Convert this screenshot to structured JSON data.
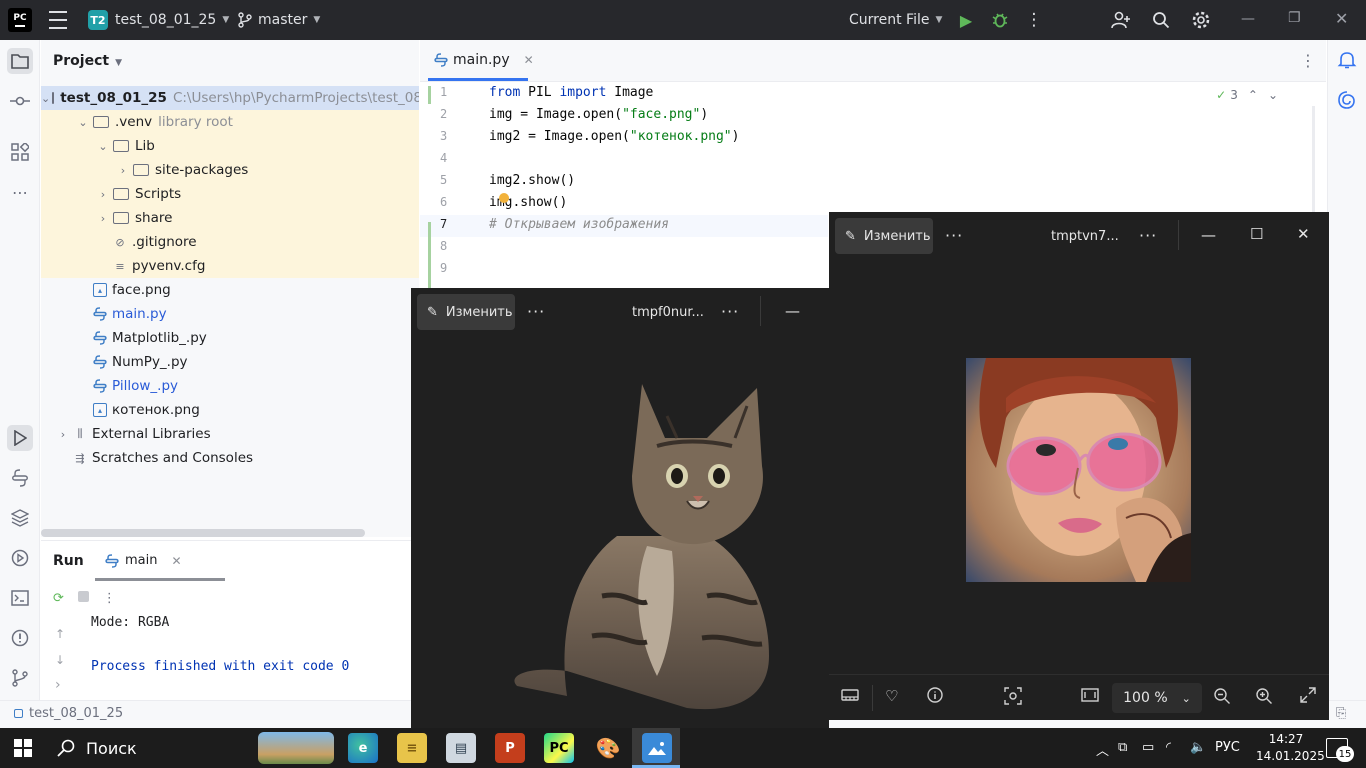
{
  "titlebar": {
    "logo": "PC",
    "project_badge": "T2",
    "project_name": "test_08_01_25",
    "branch": "master",
    "run_config": "Current File"
  },
  "project_panel": {
    "title": "Project",
    "tree": [
      {
        "label": "test_08_01_25",
        "hint": "C:\\Users\\hp\\PycharmProjects\\test_08",
        "type": "folder",
        "depth": 0,
        "expanded": true,
        "selected": true
      },
      {
        "label": ".venv",
        "hint": "library root",
        "type": "folder",
        "depth": 1,
        "expanded": true
      },
      {
        "label": "Lib",
        "type": "folder",
        "depth": 2,
        "expanded": true
      },
      {
        "label": "site-packages",
        "type": "folder",
        "depth": 3,
        "expanded": false
      },
      {
        "label": "Scripts",
        "type": "folder",
        "depth": 2,
        "expanded": false
      },
      {
        "label": "share",
        "type": "folder",
        "depth": 2,
        "expanded": false
      },
      {
        "label": ".gitignore",
        "type": "ignore",
        "depth": 2
      },
      {
        "label": "pyvenv.cfg",
        "type": "cfg",
        "depth": 2
      },
      {
        "label": "face.png",
        "type": "image",
        "depth": 1
      },
      {
        "label": "main.py",
        "type": "python",
        "depth": 1,
        "blue": true
      },
      {
        "label": "Matplotlib_.py",
        "type": "python",
        "depth": 1
      },
      {
        "label": "NumPy_.py",
        "type": "python",
        "depth": 1
      },
      {
        "label": "Pillow_.py",
        "type": "python",
        "depth": 1,
        "blue": true
      },
      {
        "label": "котенок.png",
        "type": "image",
        "depth": 1
      },
      {
        "label": "External Libraries",
        "type": "library",
        "depth": 0
      },
      {
        "label": "Scratches and Consoles",
        "type": "scratches",
        "depth": 0
      }
    ]
  },
  "editor": {
    "tab": "main.py",
    "inspections": "3",
    "lines": [
      {
        "n": "1",
        "segments": [
          {
            "t": "from",
            "c": "kw"
          },
          {
            "t": " PIL ",
            "c": ""
          },
          {
            "t": "import",
            "c": "kw"
          },
          {
            "t": " Image",
            "c": ""
          }
        ]
      },
      {
        "n": "2",
        "segments": [
          {
            "t": "img = Image.open(",
            "c": ""
          },
          {
            "t": "\"face.png\"",
            "c": "str"
          },
          {
            "t": ")",
            "c": ""
          }
        ]
      },
      {
        "n": "3",
        "segments": [
          {
            "t": "img2 = Image.open(",
            "c": ""
          },
          {
            "t": "\"котенок.png\"",
            "c": "str"
          },
          {
            "t": ")",
            "c": ""
          }
        ]
      },
      {
        "n": "4",
        "segments": []
      },
      {
        "n": "5",
        "segments": [
          {
            "t": "img2.show()",
            "c": ""
          }
        ]
      },
      {
        "n": "6",
        "segments": [
          {
            "t": "img.show()",
            "c": ""
          }
        ]
      },
      {
        "n": "7",
        "segments": [
          {
            "t": "# Открываем изображения",
            "c": "cmt"
          }
        ]
      },
      {
        "n": "8",
        "segments": []
      },
      {
        "n": "9",
        "segments": []
      }
    ]
  },
  "run_panel": {
    "title": "Run",
    "tab": "main",
    "output": [
      "Mode: RGBA",
      "",
      "Process finished with exit code 0"
    ]
  },
  "status_bar": {
    "path": "test_08_01_25"
  },
  "viewer_cat": {
    "edit_label": "Изменить",
    "file_name": "tmpf0nur..."
  },
  "viewer_face": {
    "edit_label": "Изменить",
    "file_name": "tmptvn7...",
    "zoom": "100 %"
  },
  "taskbar": {
    "search": "Поиск",
    "language": "РУС",
    "time": "14:27",
    "date": "14.01.2025",
    "notifications": "15"
  }
}
